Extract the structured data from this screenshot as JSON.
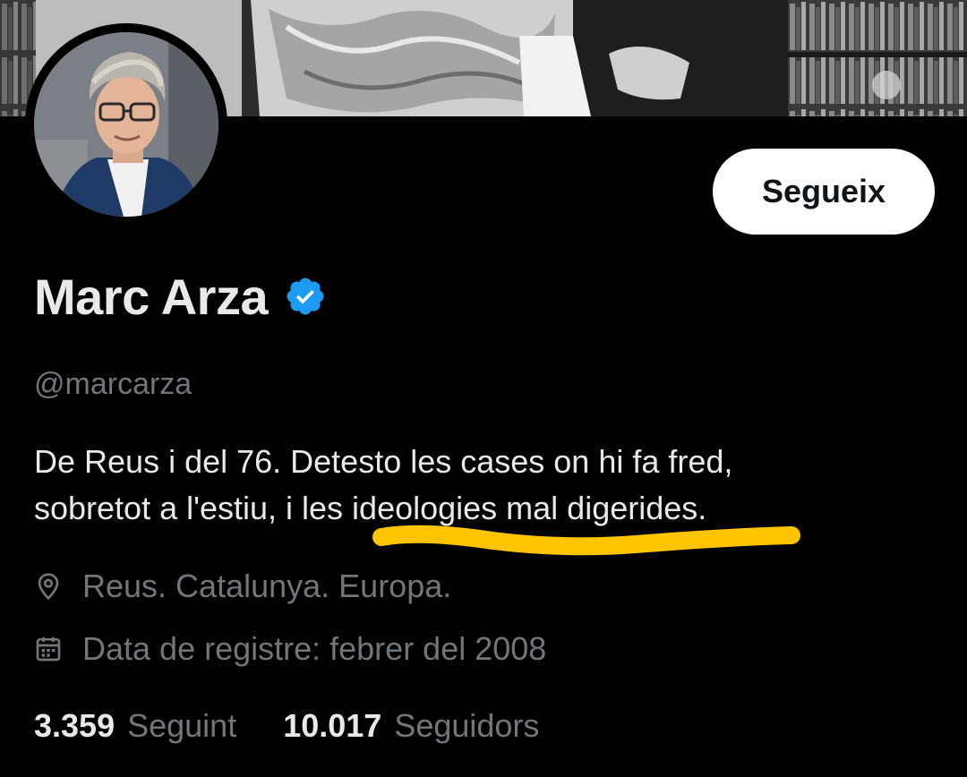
{
  "profile": {
    "display_name": "Marc Arza",
    "handle": "@marcarza",
    "verified_icon": "verified-badge-icon",
    "bio_line_1": "De Reus i del 76. Detesto les cases on hi fa fred,",
    "bio_line_2": "sobretot a l'estiu, i les ideologies mal digerides.",
    "location": "Reus. Catalunya. Europa.",
    "joined": "Data de registre: febrer del 2008"
  },
  "actions": {
    "follow_label": "Segueix"
  },
  "stats": {
    "following_count": "3.359",
    "following_label": "Seguint",
    "followers_count": "10.017",
    "followers_label": "Seguidors"
  },
  "icons": {
    "location": "map-pin-icon",
    "joined": "calendar-icon"
  },
  "colors": {
    "background": "#000000",
    "primary_text": "#e7e9ea",
    "secondary_text": "#71767b",
    "verified_blue": "#1d9bf0",
    "follow_button_bg": "#ffffff",
    "annotation_highlight": "#ffc400"
  }
}
